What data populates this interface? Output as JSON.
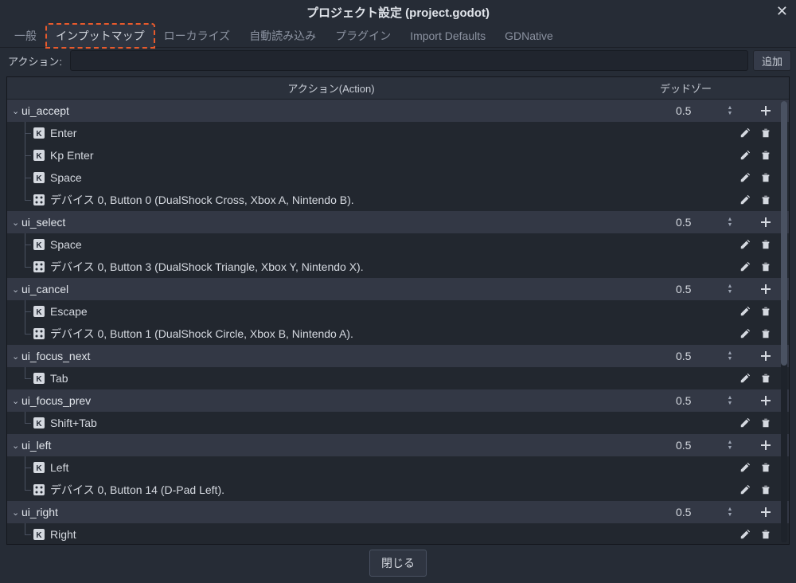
{
  "title": "プロジェクト設定 (project.godot)",
  "tabs": [
    "一般",
    "インプットマップ",
    "ローカライズ",
    "自動読み込み",
    "プラグイン",
    "Import Defaults",
    "GDNative"
  ],
  "active_tab_index": 1,
  "highlighted_tab_index": 1,
  "action_bar": {
    "label": "アクション:",
    "input_value": "",
    "add_button": "追加"
  },
  "columns": {
    "action": "アクション(Action)",
    "deadzone": "デッドゾー"
  },
  "actions": [
    {
      "name": "ui_accept",
      "deadzone": "0.5",
      "events": [
        {
          "icon": "key",
          "label": "Enter"
        },
        {
          "icon": "key",
          "label": "Kp Enter"
        },
        {
          "icon": "key",
          "label": "Space"
        },
        {
          "icon": "pad",
          "label": "デバイス 0, Button 0 (DualShock Cross, Xbox A, Nintendo B)."
        }
      ]
    },
    {
      "name": "ui_select",
      "deadzone": "0.5",
      "events": [
        {
          "icon": "key",
          "label": "Space"
        },
        {
          "icon": "pad",
          "label": "デバイス 0, Button 3 (DualShock Triangle, Xbox Y, Nintendo X)."
        }
      ]
    },
    {
      "name": "ui_cancel",
      "deadzone": "0.5",
      "events": [
        {
          "icon": "key",
          "label": "Escape"
        },
        {
          "icon": "pad",
          "label": "デバイス 0, Button 1 (DualShock Circle, Xbox B, Nintendo A)."
        }
      ]
    },
    {
      "name": "ui_focus_next",
      "deadzone": "0.5",
      "events": [
        {
          "icon": "key",
          "label": "Tab"
        }
      ]
    },
    {
      "name": "ui_focus_prev",
      "deadzone": "0.5",
      "events": [
        {
          "icon": "key",
          "label": "Shift+Tab"
        }
      ]
    },
    {
      "name": "ui_left",
      "deadzone": "0.5",
      "events": [
        {
          "icon": "key",
          "label": "Left"
        },
        {
          "icon": "pad",
          "label": "デバイス 0, Button 14 (D-Pad Left)."
        }
      ]
    },
    {
      "name": "ui_right",
      "deadzone": "0.5",
      "events": [
        {
          "icon": "key",
          "label": "Right"
        }
      ]
    }
  ],
  "footer": {
    "close_button": "閉じる"
  }
}
